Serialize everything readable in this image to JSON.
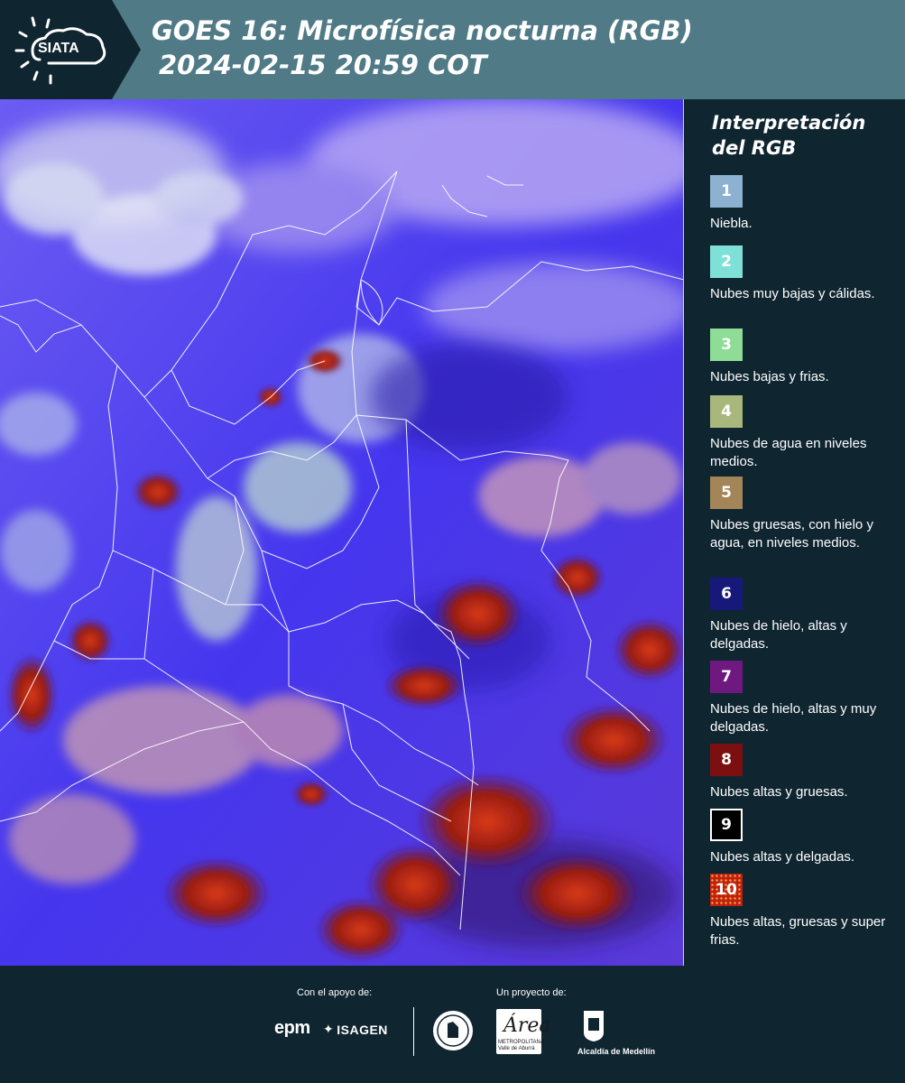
{
  "header": {
    "logo_text": "SIATA",
    "title": "GOES 16: Microfísica nocturna (RGB)",
    "datetime": "2024-02-15 20:59 COT"
  },
  "legend": {
    "title": "Interpretación del RGB",
    "items": [
      {
        "number": "1",
        "label": "Niebla.",
        "color": "#8db1d1"
      },
      {
        "number": "2",
        "label": "Nubes muy bajas y cálidas.",
        "color": "#7fe0d8"
      },
      {
        "number": "3",
        "label": "Nubes bajas y frias.",
        "color": "#8fdc96"
      },
      {
        "number": "4",
        "label": "Nubes de agua en niveles medios.",
        "color": "#a8b77c"
      },
      {
        "number": "5",
        "label": "Nubes gruesas, con hielo y agua, en niveles medios.",
        "color": "#a48557"
      },
      {
        "number": "6",
        "label": "Nubes de hielo, altas y delgadas.",
        "color": "#17197a"
      },
      {
        "number": "7",
        "label": "Nubes de hielo, altas y muy delgadas.",
        "color": "#6e1880"
      },
      {
        "number": "8",
        "label": "Nubes altas y gruesas.",
        "color": "#7c1010"
      },
      {
        "number": "9",
        "label": "Nubes altas y delgadas.",
        "color": "#000000"
      },
      {
        "number": "10",
        "label": "Nubes altas, gruesas y super frias.",
        "color": "#c0200c"
      }
    ]
  },
  "footer": {
    "support_caption": "Con el apoyo de:",
    "project_caption": "Un proyecto de:",
    "sponsor_epm": "epm",
    "sponsor_isagen": "ISAGEN",
    "area_logo_title": "Área",
    "area_logo_subtitle": "METROPOLITANA Valle de Aburrá",
    "alcaldia": "Alcaldía de Medellín"
  },
  "colors": {
    "header_bg": "#4f7a86",
    "panel_bg": "#0f2530",
    "sat_base": "#4a3cf0"
  }
}
